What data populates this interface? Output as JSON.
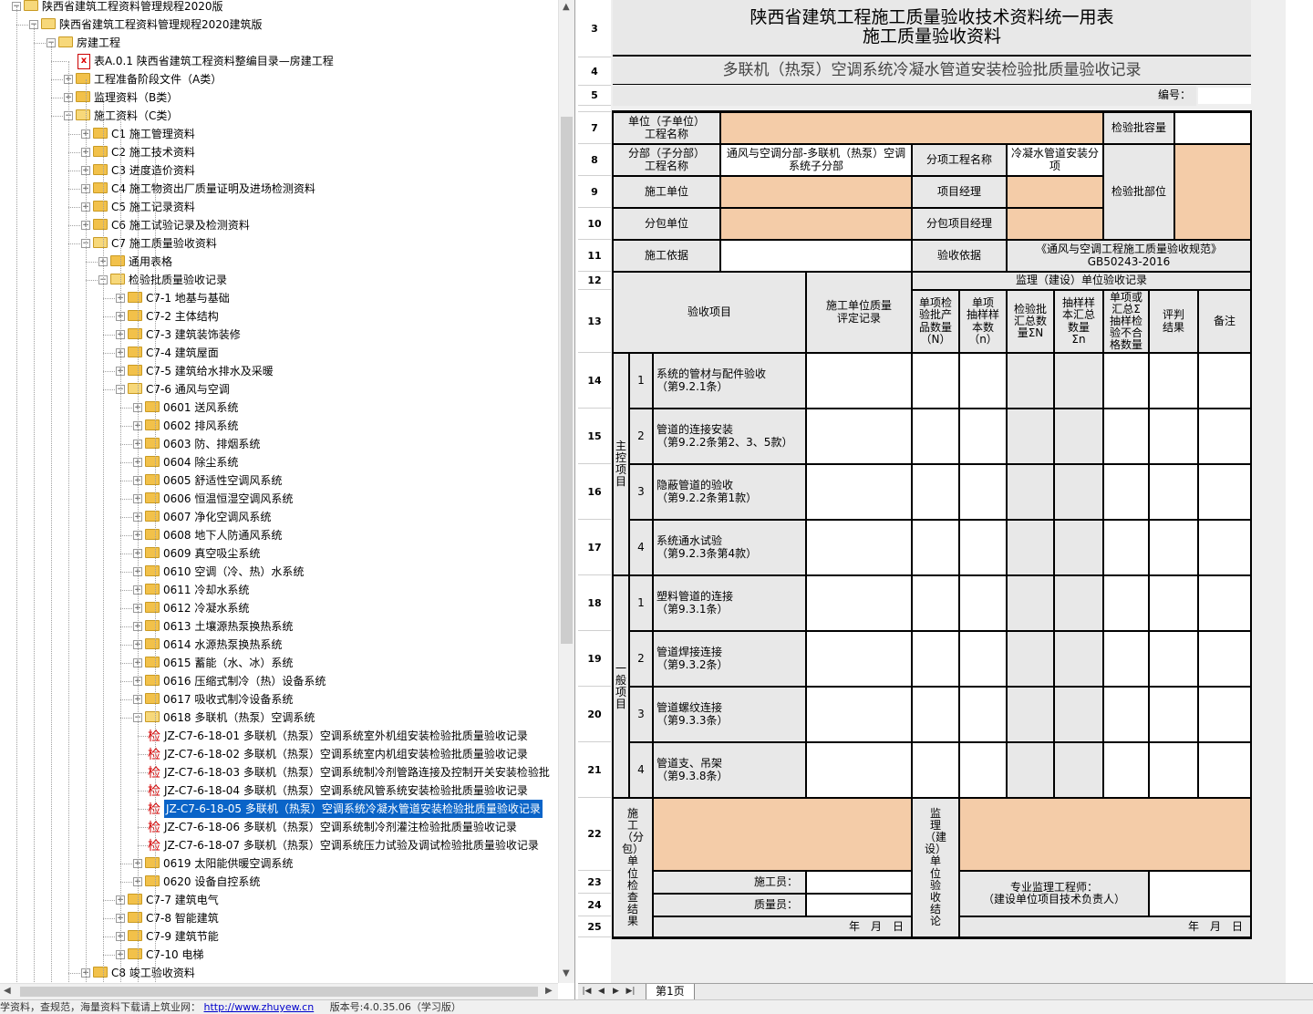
{
  "tree": {
    "items": [
      {
        "label": "陕西省建筑工程资料管理规程2020版",
        "level": 0,
        "type": "folder",
        "expanded": true
      },
      {
        "label": "陕西省建筑工程资料管理规程2020建筑版",
        "level": 1,
        "type": "folder",
        "expanded": true
      },
      {
        "label": "房建工程",
        "level": 2,
        "type": "folder",
        "expanded": true
      },
      {
        "label": "表A.0.1 陕西省建筑工程资料整编目录—房建工程",
        "level": 3,
        "type": "pdf"
      },
      {
        "label": "工程准备阶段文件（A类）",
        "level": 3,
        "type": "folder",
        "expanded": false
      },
      {
        "label": "监理资料（B类）",
        "level": 3,
        "type": "folder",
        "expanded": false
      },
      {
        "label": "施工资料（C类）",
        "level": 3,
        "type": "folder",
        "expanded": true
      },
      {
        "label": "C1 施工管理资料",
        "level": 4,
        "type": "folder",
        "expanded": false
      },
      {
        "label": "C2 施工技术资料",
        "level": 4,
        "type": "folder",
        "expanded": false
      },
      {
        "label": "C3 进度造价资料",
        "level": 4,
        "type": "folder",
        "expanded": false
      },
      {
        "label": "C4 施工物资出厂质量证明及进场检测资料",
        "level": 4,
        "type": "folder",
        "expanded": false
      },
      {
        "label": "C5 施工记录资料",
        "level": 4,
        "type": "folder",
        "expanded": false
      },
      {
        "label": "C6 施工试验记录及检测资料",
        "level": 4,
        "type": "folder",
        "expanded": false
      },
      {
        "label": "C7 施工质量验收资料",
        "level": 4,
        "type": "folder",
        "expanded": true
      },
      {
        "label": "通用表格",
        "level": 5,
        "type": "folder",
        "expanded": false
      },
      {
        "label": "检验批质量验收记录",
        "level": 5,
        "type": "folder",
        "expanded": true
      },
      {
        "label": "C7-1 地基与基础",
        "level": 6,
        "type": "folder",
        "expanded": false
      },
      {
        "label": "C7-2 主体结构",
        "level": 6,
        "type": "folder",
        "expanded": false
      },
      {
        "label": "C7-3 建筑装饰装修",
        "level": 6,
        "type": "folder",
        "expanded": false
      },
      {
        "label": "C7-4 建筑屋面",
        "level": 6,
        "type": "folder",
        "expanded": false
      },
      {
        "label": "C7-5 建筑给水排水及采暖",
        "level": 6,
        "type": "folder",
        "expanded": false
      },
      {
        "label": "C7-6 通风与空调",
        "level": 6,
        "type": "folder",
        "expanded": true
      },
      {
        "label": "0601 送风系统",
        "level": 7,
        "type": "folder",
        "expanded": false
      },
      {
        "label": "0602 排风系统",
        "level": 7,
        "type": "folder",
        "expanded": false
      },
      {
        "label": "0603 防、排烟系统",
        "level": 7,
        "type": "folder",
        "expanded": false
      },
      {
        "label": "0604 除尘系统",
        "level": 7,
        "type": "folder",
        "expanded": false
      },
      {
        "label": "0605 舒适性空调风系统",
        "level": 7,
        "type": "folder",
        "expanded": false
      },
      {
        "label": "0606 恒温恒湿空调风系统",
        "level": 7,
        "type": "folder",
        "expanded": false
      },
      {
        "label": "0607 净化空调风系统",
        "level": 7,
        "type": "folder",
        "expanded": false
      },
      {
        "label": "0608 地下人防通风系统",
        "level": 7,
        "type": "folder",
        "expanded": false
      },
      {
        "label": "0609 真空吸尘系统",
        "level": 7,
        "type": "folder",
        "expanded": false
      },
      {
        "label": "0610 空调（冷、热）水系统",
        "level": 7,
        "type": "folder",
        "expanded": false
      },
      {
        "label": "0611 冷却水系统",
        "level": 7,
        "type": "folder",
        "expanded": false
      },
      {
        "label": "0612 冷凝水系统",
        "level": 7,
        "type": "folder",
        "expanded": false
      },
      {
        "label": "0613 土壤源热泵换热系统",
        "level": 7,
        "type": "folder",
        "expanded": false
      },
      {
        "label": "0614 水源热泵换热系统",
        "level": 7,
        "type": "folder",
        "expanded": false
      },
      {
        "label": "0615 蓄能（水、冰）系统",
        "level": 7,
        "type": "folder",
        "expanded": false
      },
      {
        "label": "0616 压缩式制冷（热）设备系统",
        "level": 7,
        "type": "folder",
        "expanded": false
      },
      {
        "label": "0617 吸收式制冷设备系统",
        "level": 7,
        "type": "folder",
        "expanded": false
      },
      {
        "label": "0618 多联机（热泵）空调系统",
        "level": 7,
        "type": "folder",
        "expanded": true
      },
      {
        "label": "JZ-C7-6-18-01 多联机（热泵）空调系统室外机组安装检验批质量验收记录",
        "level": 8,
        "type": "jian"
      },
      {
        "label": "JZ-C7-6-18-02 多联机（热泵）空调系统室内机组安装检验批质量验收记录",
        "level": 8,
        "type": "jian"
      },
      {
        "label": "JZ-C7-6-18-03 多联机（热泵）空调系统制冷剂管路连接及控制开关安装检验批",
        "level": 8,
        "type": "jian"
      },
      {
        "label": "JZ-C7-6-18-04 多联机（热泵）空调系统风管系统安装检验批质量验收记录",
        "level": 8,
        "type": "jian"
      },
      {
        "label": "JZ-C7-6-18-05 多联机（热泵）空调系统冷凝水管道安装检验批质量验收记录",
        "level": 8,
        "type": "jian",
        "selected": true
      },
      {
        "label": "JZ-C7-6-18-06 多联机（热泵）空调系统制冷剂灌注检验批质量验收记录",
        "level": 8,
        "type": "jian"
      },
      {
        "label": "JZ-C7-6-18-07 多联机（热泵）空调系统压力试验及调试检验批质量验收记录",
        "level": 8,
        "type": "jian"
      },
      {
        "label": "0619 太阳能供暖空调系统",
        "level": 7,
        "type": "folder",
        "expanded": false
      },
      {
        "label": "0620 设备自控系统",
        "level": 7,
        "type": "folder",
        "expanded": false
      },
      {
        "label": "C7-7 建筑电气",
        "level": 6,
        "type": "folder",
        "expanded": false
      },
      {
        "label": "C7-8 智能建筑",
        "level": 6,
        "type": "folder",
        "expanded": false
      },
      {
        "label": "C7-9 建筑节能",
        "level": 6,
        "type": "folder",
        "expanded": false
      },
      {
        "label": "C7-10 电梯",
        "level": 6,
        "type": "folder",
        "expanded": false
      },
      {
        "label": "C8 竣工验收资料",
        "level": 4,
        "type": "folder",
        "expanded": false
      }
    ]
  },
  "sheet": {
    "row_numbers": [
      "3",
      "4",
      "5",
      "",
      "7",
      "8",
      "9",
      "10",
      "11",
      "12",
      "13",
      "14",
      "15",
      "16",
      "17",
      "18",
      "19",
      "20",
      "21",
      "22",
      "23",
      "24",
      "25"
    ],
    "title1": "陕西省建筑工程施工质量验收技术资料统一用表",
    "title2": "施工质量验收资料",
    "subtitle": "多联机（热泵）空调系统冷凝水管道安装检验批质量验收记录",
    "code_label": "编号：",
    "r7_unit": "单位（子单位）\n工程名称",
    "r7_capacity": "检验批容量",
    "r8_part": "分部（子分部）\n工程名称",
    "r8_part_val": "通风与空调分部-多联机（热泵）空调系统子分部",
    "r8_item": "分项工程名称",
    "r8_item_val": "冷凝水管道安装分项",
    "r9_contractor": "施工单位",
    "r9_manager": "项目经理",
    "r9_location": "检验批部位",
    "r10_sub": "分包单位",
    "r10_submgr": "分包项目经理",
    "r11_basis": "施工依据",
    "r11_accept": "验收依据",
    "r11_accept_val": "《通风与空调工程施工质量验收规范》\nGB50243-2016",
    "h_supervisor": "监理（建设）单位验收记录",
    "h_item": "验收项目",
    "h_selfcheck": "施工单位质量\n评定记录",
    "h_cols": [
      "单项检\n验批产\n品数量\n（N）",
      "单项\n抽样样\n本数\n（n）",
      "检验批\n汇总数\n量ΣN",
      "抽样样\n本汇总\n数量\nΣn",
      "单项或\n汇总Σ\n抽样检\n验不合\n格数量",
      "评判\n结果",
      "备注"
    ],
    "main_label": "主\n控\n项\n目",
    "general_label": "一\n般\n项\n目",
    "main_items": [
      {
        "no": "1",
        "text": "系统的管材与配件验收\n（第9.2.1条）"
      },
      {
        "no": "2",
        "text": "管道的连接安装\n（第9.2.2条第2、3、5款）"
      },
      {
        "no": "3",
        "text": "隐蔽管道的验收\n（第9.2.2条第1款）"
      },
      {
        "no": "4",
        "text": "系统通水试验\n（第9.2.3条第4款）"
      }
    ],
    "general_items": [
      {
        "no": "1",
        "text": "塑料管道的连接\n（第9.3.1条）"
      },
      {
        "no": "2",
        "text": "管道焊接连接\n（第9.3.2条）"
      },
      {
        "no": "3",
        "text": "管道螺纹连接\n（第9.3.3条）"
      },
      {
        "no": "4",
        "text": "管道支、吊架\n（第9.3.8条）"
      }
    ],
    "footer_left": "施\n工\n（分包）\n单\n位\n检\n查\n结\n果",
    "footer_constructor": "施工员：",
    "footer_quality": "质量员：",
    "footer_date": "年　月　日",
    "footer_mid": "监\n理\n（建\n设）\n单\n位\n验\n收\n结\n论",
    "footer_engineer": "专业监理工程师：\n（建设单位项目技术负责人）",
    "footer_date2": "年　月　日",
    "tab_label": "第1页"
  },
  "status": {
    "text1": "学资料，查规范，海量资料下载请上筑业网：",
    "link": "http://www.zhuyew.cn",
    "text2": "版本号:4.0.35.06（学习版）"
  },
  "colors": {
    "tan": "#f4cca8",
    "selection": "#0a64c8",
    "folder": "#f2c14a"
  }
}
